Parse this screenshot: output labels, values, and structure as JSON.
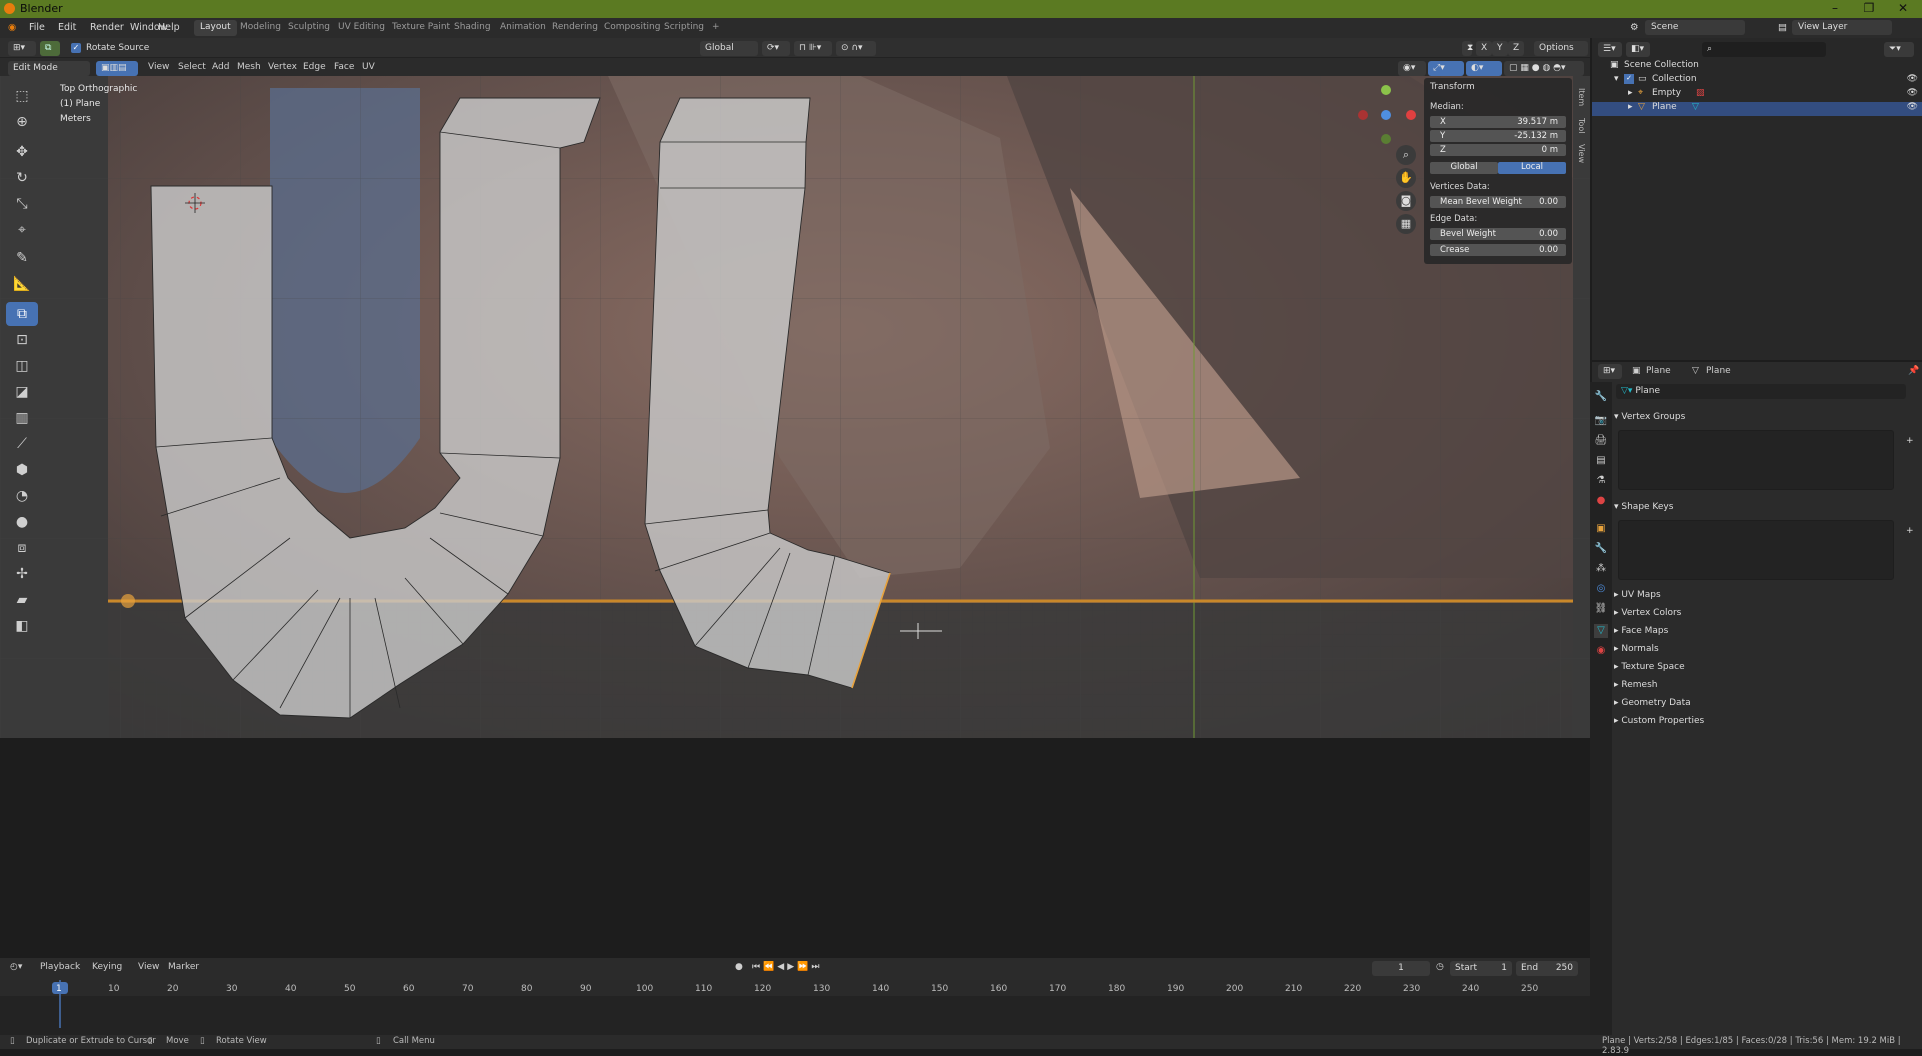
{
  "app": {
    "title": "Blender",
    "window_controls": [
      "–",
      "❐",
      "✕"
    ]
  },
  "menu": [
    "File",
    "Edit",
    "Render",
    "Window",
    "Help"
  ],
  "workspaces": {
    "active": "Layout",
    "tabs": [
      "Layout",
      "Modeling",
      "Sculpting",
      "UV Editing",
      "Texture Paint",
      "Shading",
      "Animation",
      "Rendering",
      "Compositing",
      "Scripting"
    ],
    "add": "+"
  },
  "scene": {
    "name": "Scene",
    "view_layer": "View Layer"
  },
  "tool_header": {
    "rotate_source_label": "Rotate Source",
    "rotate_source_checked": true,
    "transform_orientation": "Global",
    "options": "Options",
    "axis_x": "X",
    "axis_y": "Y",
    "axis_z": "Z"
  },
  "viewport_header": {
    "mode": "Edit Mode",
    "menus": [
      "View",
      "Select",
      "Add",
      "Mesh",
      "Vertex",
      "Edge",
      "Face",
      "UV"
    ]
  },
  "viewport_info": {
    "view": "Top Orthographic",
    "object": "(1) Plane",
    "units": "Meters"
  },
  "transform_panel": {
    "title": "Transform",
    "median_label": "Median:",
    "x_label": "X",
    "x": "39.517 m",
    "y_label": "Y",
    "y": "-25.132 m",
    "z_label": "Z",
    "z": "0 m",
    "global": "Global",
    "local": "Local",
    "vertices_data": "Vertices Data:",
    "mean_bevel_weight_label": "Mean Bevel Weight",
    "mean_bevel_weight": "0.00",
    "edge_data": "Edge Data:",
    "bevel_weight_label": "Bevel Weight",
    "bevel_weight": "0.00",
    "crease_label": "Crease",
    "crease": "0.00",
    "side_tabs": [
      "Item",
      "Tool",
      "View"
    ]
  },
  "outliner": {
    "root": "Scene Collection",
    "items": [
      {
        "label": "Collection"
      },
      {
        "label": "Empty"
      },
      {
        "label": "Plane",
        "selected": true
      }
    ]
  },
  "properties": {
    "breadcrumb_object": "Plane",
    "breadcrumb_data": "Plane",
    "data_name": "Plane",
    "sections": [
      "Vertex Groups",
      "Shape Keys",
      "UV Maps",
      "Vertex Colors",
      "Face Maps",
      "Normals",
      "Texture Space",
      "Remesh",
      "Geometry Data",
      "Custom Properties"
    ]
  },
  "timeline": {
    "menus": [
      "Playback",
      "Keying",
      "View",
      "Marker"
    ],
    "current_frame": "1",
    "start_label": "Start",
    "start": "1",
    "end_label": "End",
    "end": "250",
    "ticks": [
      "1",
      "10",
      "20",
      "30",
      "40",
      "50",
      "60",
      "70",
      "80",
      "90",
      "100",
      "110",
      "120",
      "130",
      "140",
      "150",
      "160",
      "170",
      "180",
      "190",
      "200",
      "210",
      "220",
      "230",
      "240",
      "250"
    ]
  },
  "status_bar": {
    "left1": "Duplicate or Extrude to Cursor",
    "left2": "Move",
    "left3": "Rotate View",
    "left4": "Call Menu",
    "right": "Plane | Verts:2/58 | Edges:1/85 | Faces:0/28 | Tris:56 | Mem: 19.2 MiB | 2.83.9"
  },
  "colors": {
    "accent": "#4772b3",
    "title_bar": "#5b7a22",
    "selection": "#e8a33d"
  }
}
